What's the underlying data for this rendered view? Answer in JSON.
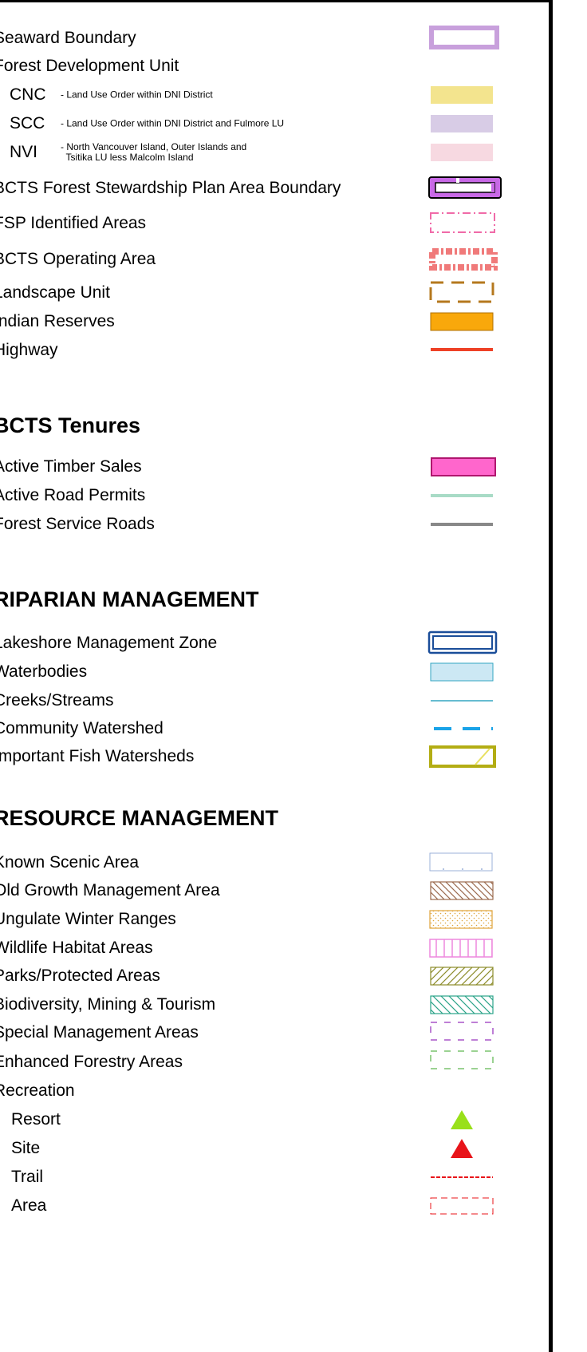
{
  "sections": [
    {
      "items": [
        {
          "label": "Seaward Boundary",
          "symbol": "seaward-boundary"
        },
        {
          "label": "Forest Development Unit",
          "symbol": ""
        },
        {
          "code": "CNC",
          "desc": "- Land Use Order within DNI District",
          "symbol": "fdu-cnc",
          "color": "#f3e48e"
        },
        {
          "code": "SCC",
          "desc": "- Land Use Order within DNI District and Fulmore LU",
          "symbol": "fdu-scc",
          "color": "#d8cce6"
        },
        {
          "code": "NVI",
          "desc": "- North Vancouver Island, Outer Islands and\n  Tsitika LU less Malcolm Island",
          "symbol": "fdu-nvi",
          "color": "#f7d9e1"
        },
        {
          "label": "BCTS Forest Stewardship Plan Area Boundary",
          "symbol": "fsp-boundary"
        },
        {
          "label": "FSP Identified Areas",
          "symbol": "fsp-identified"
        },
        {
          "label": "BCTS Operating Area",
          "symbol": "operating-area"
        },
        {
          "label": "Landscape Unit",
          "symbol": "landscape-unit"
        },
        {
          "label": "Indian Reserves",
          "symbol": "indian-reserves",
          "color": "#f9a80b"
        },
        {
          "label": "Highway",
          "symbol": "highway",
          "color": "#ee4126"
        }
      ]
    },
    {
      "heading": "BCTS Tenures",
      "items": [
        {
          "label": "Active Timber Sales",
          "symbol": "timber-sales",
          "color": "#ff66cc"
        },
        {
          "label": "Active Road Permits",
          "symbol": "road-permits",
          "color": "#a8dbc6"
        },
        {
          "label": "Forest Service Roads",
          "symbol": "fs-roads",
          "color": "#888888"
        }
      ]
    },
    {
      "heading": "RIPARIAN MANAGEMENT",
      "items": [
        {
          "label": "Lakeshore Management Zone",
          "symbol": "lakeshore",
          "color": "#1a4d99"
        },
        {
          "label": "Waterbodies",
          "symbol": "waterbodies",
          "color": "#cce8f4"
        },
        {
          "label": "Creeks/Streams",
          "symbol": "creeks",
          "color": "#33a6c2"
        },
        {
          "label": "Community Watershed",
          "symbol": "community-watershed",
          "color": "#1aa3e8"
        },
        {
          "label": "Important Fish Watersheds",
          "symbol": "fish-watersheds",
          "color": "#b3ad14"
        }
      ]
    },
    {
      "heading": "RESOURCE MANAGEMENT",
      "items": [
        {
          "label": "Known Scenic Area",
          "symbol": "scenic"
        },
        {
          "label": "Old Growth Management Area",
          "symbol": "old-growth",
          "color": "#9b6a4e"
        },
        {
          "label": "Ungulate Winter Ranges",
          "symbol": "ungulate",
          "color": "#e0a43a"
        },
        {
          "label": "Wildlife Habitat Areas",
          "symbol": "wildlife",
          "color": "#ee88dd"
        },
        {
          "label": "Parks/Protected Areas",
          "symbol": "parks",
          "color": "#8c8c2a"
        },
        {
          "label": "Biodiversity, Mining & Tourism",
          "symbol": "biodiversity",
          "color": "#2aa388"
        },
        {
          "label": "Special Management Areas",
          "symbol": "special",
          "color": "#a855c8"
        },
        {
          "label": "Enhanced Forestry Areas",
          "symbol": "enhanced",
          "color": "#7ac46e"
        },
        {
          "label": "Recreation",
          "symbol": ""
        },
        {
          "sublabel": "Resort",
          "symbol": "resort",
          "color": "#99e01a"
        },
        {
          "sublabel": "Site",
          "symbol": "site",
          "color": "#e8141a"
        },
        {
          "sublabel": "Trail",
          "symbol": "trail",
          "color": "#e8141a"
        },
        {
          "sublabel": "Area",
          "symbol": "rec-area",
          "color": "#e8141a"
        }
      ]
    }
  ]
}
